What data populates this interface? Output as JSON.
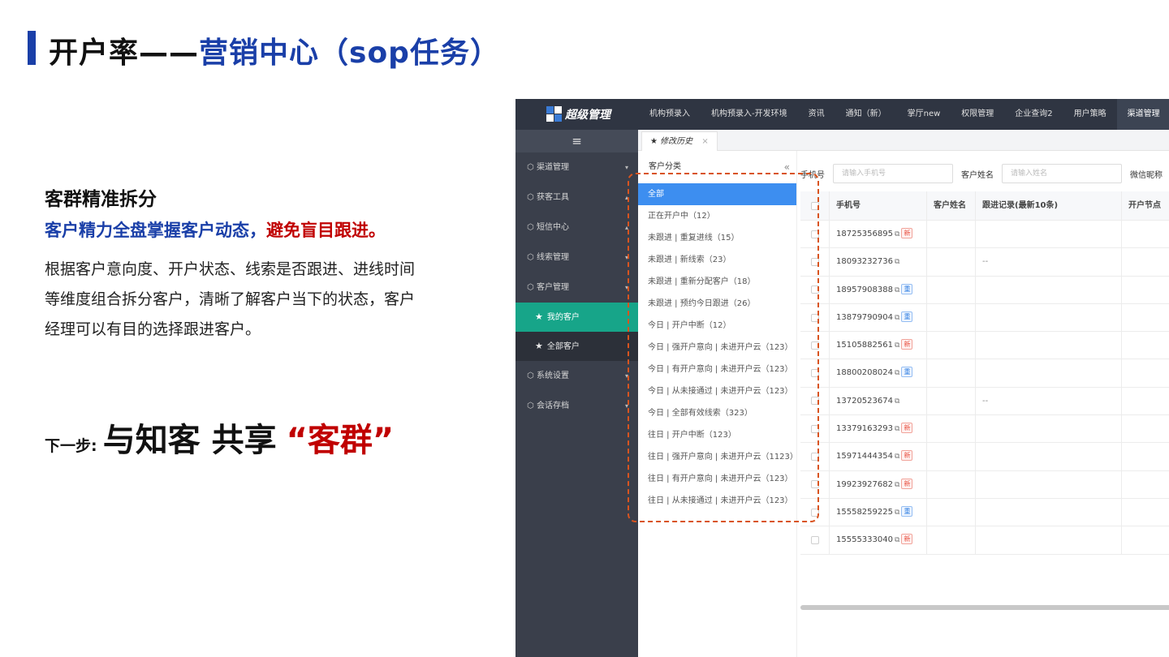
{
  "slide": {
    "title_part1": "开户率——",
    "title_part2": "营销中心（sop任务）",
    "section_heading": "客群精准拆分",
    "subheading_blue": "客户精力全盘掌握客户动态，",
    "subheading_red": "避免盲目跟进。",
    "body_text": "根据客户意向度、开户状态、线索是否跟进、进线时间等维度组合拆分客户，清晰了解客户当下的状态，客户经理可以有目的选择跟进客户。",
    "next_step_label": "下一步:",
    "next_step_main": "与知客 共享",
    "next_step_highlight": "“客群”"
  },
  "app": {
    "logo_text": "超级管理",
    "nav": [
      "机构预录入",
      "机构预录入-开发环境",
      "资讯",
      "通知（新）",
      "掌厅new",
      "权限管理",
      "企业查询2",
      "用户策略",
      "渠道管理"
    ],
    "nav_active_index": 8,
    "menu_icon": "hamburger-icon",
    "sidebar": [
      {
        "label": "渠道管理",
        "icon": "cube-icon",
        "arrow": "▾"
      },
      {
        "label": "获客工具",
        "icon": "cube-icon",
        "arrow": "▴"
      },
      {
        "label": "短信中心",
        "icon": "cube-icon",
        "arrow": "▴"
      },
      {
        "label": "线索管理",
        "icon": "cube-icon",
        "arrow": "▾"
      },
      {
        "label": "客户管理",
        "icon": "cube-icon",
        "arrow": "▾"
      }
    ],
    "sidebar_sub": [
      {
        "label": "我的客户",
        "icon": "star-icon"
      },
      {
        "label": "全部客户",
        "icon": "star-icon"
      }
    ],
    "sidebar_after": [
      {
        "label": "系统设置",
        "icon": "cube-icon",
        "arrow": "▾"
      },
      {
        "label": "会话存档",
        "icon": "cube-icon",
        "arrow": "▾"
      }
    ],
    "tab_label": "修改历史",
    "tab_close": "×",
    "category_header": "客户分类",
    "collapse_glyph": "«",
    "categories": [
      "全部",
      "正在开户中（12）",
      "未跟进 | 重复进线（15）",
      "未跟进 | 新线索（23）",
      "未跟进 | 重新分配客户（18）",
      "未跟进 | 预约今日跟进（26）",
      "今日 | 开户中断（12）",
      "今日 | 强开户意向 | 未进开户云（123）",
      "今日 | 有开户意向 | 未进开户云（123）",
      "今日 | 从未接通过 | 未进开户云（123）",
      "今日 | 全部有效线索（323）",
      "往日 | 开户中断（123）",
      "往日 | 强开户意向 | 未进开户云（1123）",
      "往日 | 有开户意向 | 未进开户云（123）",
      "往日 | 从未接通过 | 未进开户云（123）"
    ],
    "filter": {
      "phone_label": "手机号",
      "phone_placeholder": "请输入手机号",
      "name_label": "客户姓名",
      "name_placeholder": "请输入姓名",
      "wechat_label": "微信昵称"
    },
    "table_headers": [
      "手机号",
      "客户姓名",
      "跟进记录(最新10条)",
      "开户节点"
    ],
    "rows": [
      {
        "phone": "18725356895",
        "tag": "新",
        "tag_type": "new",
        "follow": ""
      },
      {
        "phone": "18093232736",
        "tag": "",
        "tag_type": "",
        "follow": "--"
      },
      {
        "phone": "18957908388",
        "tag": "重",
        "tag_type": "rep",
        "follow": ""
      },
      {
        "phone": "13879790904",
        "tag": "重",
        "tag_type": "rep",
        "follow": ""
      },
      {
        "phone": "15105882561",
        "tag": "新",
        "tag_type": "new",
        "follow": ""
      },
      {
        "phone": "18800208024",
        "tag": "重",
        "tag_type": "rep",
        "follow": ""
      },
      {
        "phone": "13720523674",
        "tag": "",
        "tag_type": "",
        "follow": "--"
      },
      {
        "phone": "13379163293",
        "tag": "新",
        "tag_type": "new",
        "follow": ""
      },
      {
        "phone": "15971444354",
        "tag": "新",
        "tag_type": "new",
        "follow": ""
      },
      {
        "phone": "19923927682",
        "tag": "新",
        "tag_type": "new",
        "follow": ""
      },
      {
        "phone": "15558259225",
        "tag": "重",
        "tag_type": "rep",
        "follow": ""
      },
      {
        "phone": "15555333040",
        "tag": "新",
        "tag_type": "new",
        "follow": ""
      }
    ]
  }
}
